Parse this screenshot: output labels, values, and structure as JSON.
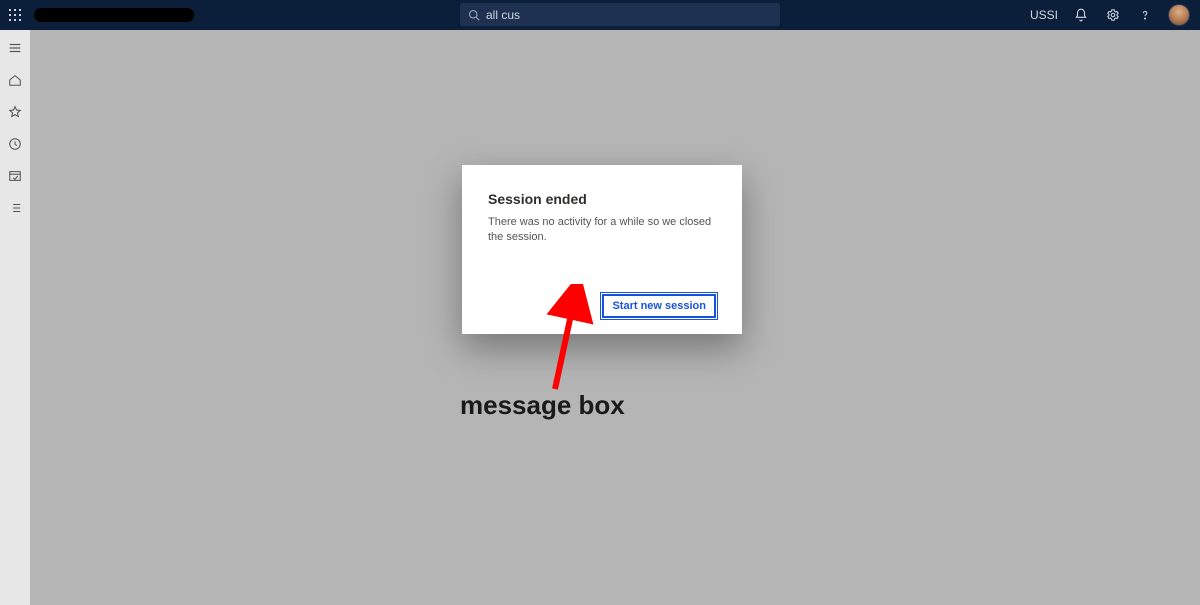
{
  "topbar": {
    "search_value": "all cus",
    "org_label": "USSI"
  },
  "dialog": {
    "title": "Session ended",
    "message": "There was no activity for a while so we closed the session.",
    "primary_button": "Start new session"
  },
  "annotation": {
    "label": "message box"
  }
}
